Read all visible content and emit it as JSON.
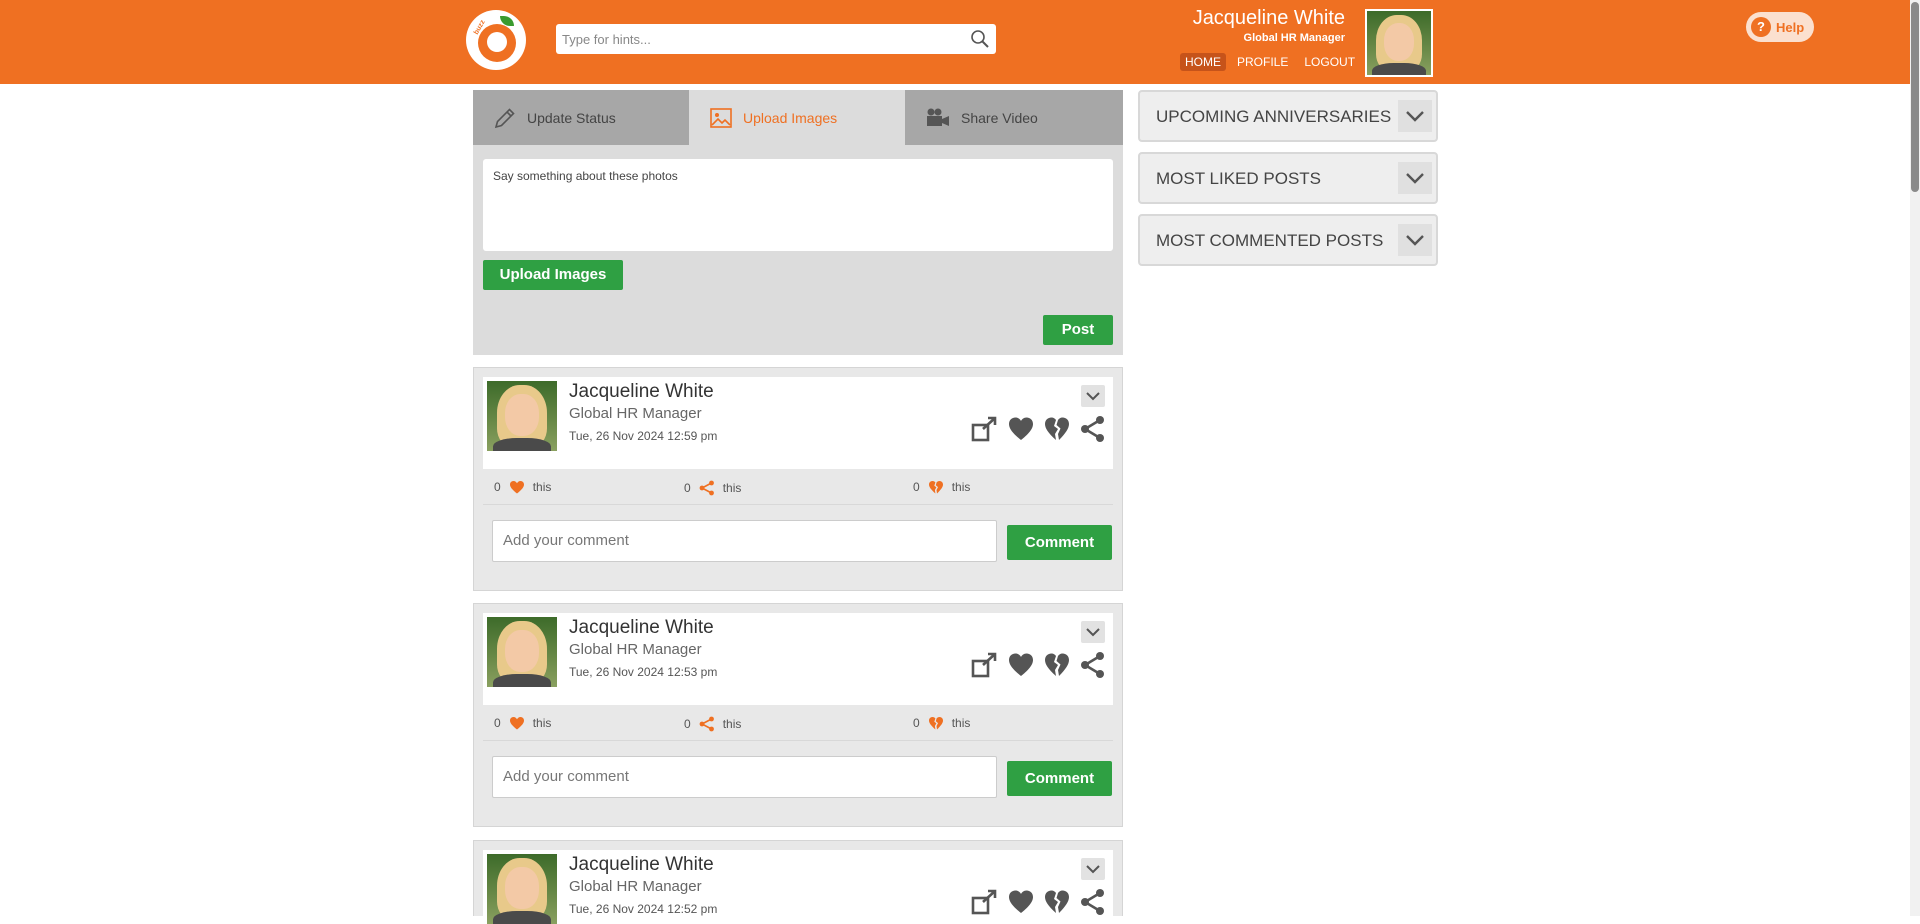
{
  "header": {
    "brand": "buzz",
    "search_placeholder": "Type for hints...",
    "user_name": "Jacqueline White",
    "user_role": "Global HR Manager",
    "nav": [
      {
        "label": "HOME",
        "active": true
      },
      {
        "label": "PROFILE",
        "active": false
      },
      {
        "label": "LOGOUT",
        "active": false
      }
    ],
    "help_label": "Help",
    "help_glyph": "?"
  },
  "composer": {
    "tabs": [
      {
        "label": "Update Status",
        "icon": "pencil-icon"
      },
      {
        "label": "Upload Images",
        "icon": "image-icon"
      },
      {
        "label": "Share Video",
        "icon": "video-camera-icon"
      }
    ],
    "active_tab": 1,
    "text_placeholder": "Say something about these photos",
    "upload_label": "Upload Images",
    "post_label": "Post"
  },
  "posts": [
    {
      "author": "Jacqueline White",
      "role": "Global HR Manager",
      "date": "Tue, 26 Nov 2024  12:59 pm",
      "likes": "0",
      "shares": "0",
      "dislikes": "0",
      "this_label": "this",
      "comment_placeholder": "Add your comment",
      "comment_label": "Comment"
    },
    {
      "author": "Jacqueline White",
      "role": "Global HR Manager",
      "date": "Tue, 26 Nov 2024  12:53 pm",
      "likes": "0",
      "shares": "0",
      "dislikes": "0",
      "this_label": "this",
      "comment_placeholder": "Add your comment",
      "comment_label": "Comment"
    },
    {
      "author": "Jacqueline White",
      "role": "Global HR Manager",
      "date": "Tue, 26 Nov 2024  12:52 pm"
    }
  ],
  "widgets": [
    {
      "label": "Upcoming Anniversaries"
    },
    {
      "label": "Most Liked Posts"
    },
    {
      "label": "Most Commented Posts"
    }
  ],
  "colors": {
    "accent": "#ef7022",
    "button_green": "#2fa043",
    "panel_grey": "#dcdcdc"
  }
}
